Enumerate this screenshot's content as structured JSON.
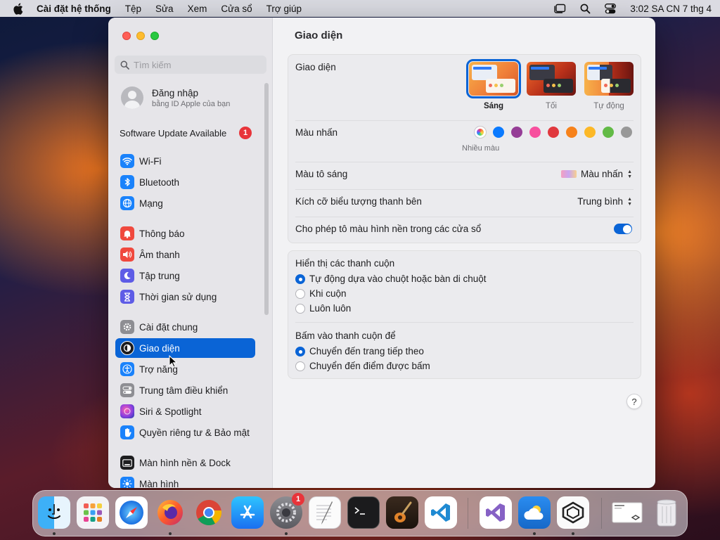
{
  "menubar": {
    "app_name": "Cài đặt hệ thống",
    "menus": [
      "Tệp",
      "Sửa",
      "Xem",
      "Cửa sổ",
      "Trợ giúp"
    ],
    "clock": "3:02 SA CN 7 thg 4"
  },
  "sidebar": {
    "search_placeholder": "Tìm kiếm",
    "account": {
      "title": "Đăng nhập",
      "subtitle": "bằng ID Apple của bạn"
    },
    "update": {
      "label": "Software Update Available",
      "badge": "1"
    },
    "items": [
      {
        "label": "Wi-Fi",
        "icon": "wifi-icon",
        "color": "#1a82fb"
      },
      {
        "label": "Bluetooth",
        "icon": "bluetooth-icon",
        "color": "#1a82fb"
      },
      {
        "label": "Mạng",
        "icon": "globe-icon",
        "color": "#1a82fb"
      },
      {
        "label": "Thông báo",
        "icon": "bell-icon",
        "color": "#f0493e"
      },
      {
        "label": "Âm thanh",
        "icon": "speaker-icon",
        "color": "#f0493e"
      },
      {
        "label": "Tập trung",
        "icon": "moon-icon",
        "color": "#5e5ce6"
      },
      {
        "label": "Thời gian sử dụng",
        "icon": "hourglass-icon",
        "color": "#5e5ce6"
      },
      {
        "label": "Cài đặt chung",
        "icon": "gear-icon",
        "color": "#8e8e93"
      },
      {
        "label": "Giao diện",
        "icon": "appearance-icon",
        "color": "#1d1d1f"
      },
      {
        "label": "Trợ năng",
        "icon": "accessibility-icon",
        "color": "#1a82fb"
      },
      {
        "label": "Trung tâm điều khiển",
        "icon": "control-center-icon",
        "color": "#8e8e93"
      },
      {
        "label": "Siri & Spotlight",
        "icon": "siri-icon",
        "color": "#c23fd8"
      },
      {
        "label": "Quyền riêng tư & Bảo mật",
        "icon": "hand-icon",
        "color": "#1a82fb"
      },
      {
        "label": "Màn hình nền & Dock",
        "icon": "dock-icon",
        "color": "#1d1d1f"
      },
      {
        "label": "Màn hình",
        "icon": "sun-icon",
        "color": "#1a82fb"
      }
    ],
    "active_item": "Giao diện"
  },
  "main": {
    "title": "Giao diện",
    "appearance": {
      "label": "Giao diện",
      "options": [
        {
          "label": "Sáng",
          "selected": true
        },
        {
          "label": "Tối",
          "selected": false
        },
        {
          "label": "Tự động",
          "selected": false
        }
      ]
    },
    "accent": {
      "label": "Màu nhấn",
      "selected_caption": "Nhiều màu",
      "colors": [
        "multicolor",
        "#0a7aff",
        "#953d96",
        "#f74f9e",
        "#e0383e",
        "#f7821b",
        "#fcb827",
        "#62ba46",
        "#989898"
      ]
    },
    "highlight": {
      "label": "Màu tô sáng",
      "value": "Màu nhấn"
    },
    "sidebar_icon_size": {
      "label": "Kích cỡ biểu tượng thanh bên",
      "value": "Trung bình"
    },
    "wallpaper_tinting": {
      "label": "Cho phép tô màu hình nền trong các cửa sổ",
      "enabled": true
    },
    "scrollbars": {
      "title": "Hiển thị các thanh cuộn",
      "options": [
        {
          "label": "Tự động dựa vào chuột hoặc bàn di chuột",
          "selected": true
        },
        {
          "label": "Khi cuộn",
          "selected": false
        },
        {
          "label": "Luôn luôn",
          "selected": false
        }
      ]
    },
    "click_scrollbar": {
      "title": "Bấm vào thanh cuộn để",
      "options": [
        {
          "label": "Chuyển đến trang tiếp theo",
          "selected": true
        },
        {
          "label": "Chuyển đến điểm được bấm",
          "selected": false
        }
      ]
    },
    "help": "?"
  },
  "dock": {
    "apps": [
      "Finder",
      "Launchpad",
      "Safari",
      "Firefox",
      "Chrome",
      "App Store",
      "System Settings",
      "TextEdit",
      "Terminal",
      "GarageBand",
      "VS Code",
      "Visual Studio",
      "Weather",
      "Parallels",
      "Screenshot",
      "Trash"
    ],
    "settings_badge": "1"
  }
}
